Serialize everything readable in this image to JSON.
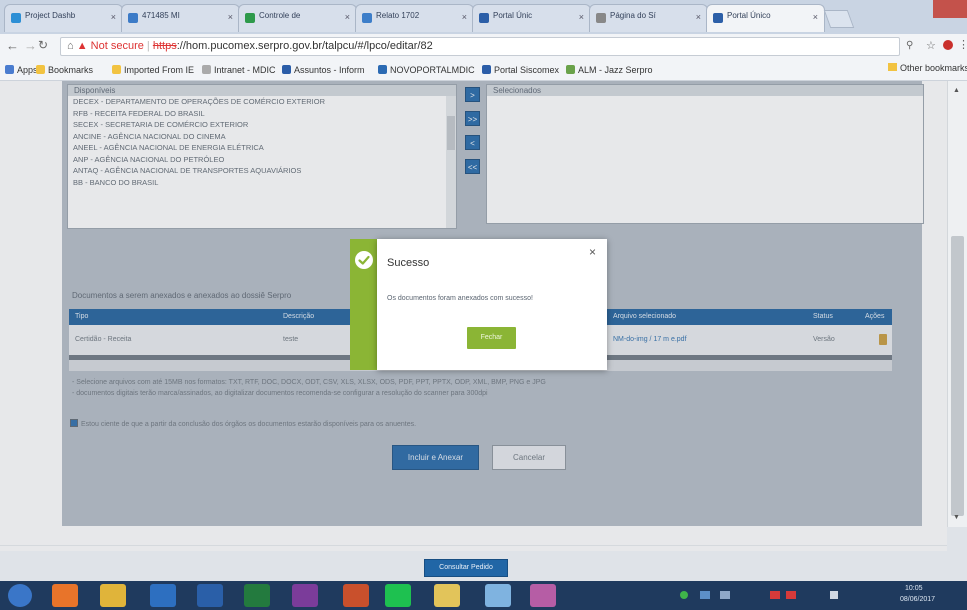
{
  "browser": {
    "tabs": [
      {
        "title": "Project Dashb",
        "fav": "#2d8fd5",
        "active": false
      },
      {
        "title": "471485 MI",
        "fav": "#3c7bc7",
        "active": false
      },
      {
        "title": "Controle de",
        "fav": "#2e9a4b",
        "active": false
      },
      {
        "title": "Relato 1702",
        "fav": "#3d7ec9",
        "active": false
      },
      {
        "title": "Portal Únic",
        "fav": "#2c5fa8",
        "active": false
      },
      {
        "title": "Página do Sí",
        "fav": "#888888",
        "active": false
      },
      {
        "title": "Portal Único",
        "fav": "#2c5fa8",
        "active": true
      }
    ],
    "not_secure_label": "Not secure",
    "url_scheme": "https",
    "url_rest": "://hom.pucomex.serpro.gov.br/talpcu/#/lpco/editar/82",
    "bookmarks": [
      {
        "label": "Apps",
        "color": "#4a7ccf"
      },
      {
        "label": "Bookmarks",
        "color": "#f2c341"
      },
      {
        "label": "Imported From IE",
        "color": "#f2c341"
      },
      {
        "label": "Intranet - MDIC",
        "color": "#aaaaaa"
      },
      {
        "label": "Assuntos - Inform",
        "color": "#2b5da8"
      },
      {
        "label": "NOVOPORTALMDIC",
        "color": "#2b6ab3"
      },
      {
        "label": "Portal Siscomex",
        "color": "#2b5da8"
      },
      {
        "label": "ALM - Jazz Serpro",
        "color": "#6aa24a"
      }
    ],
    "other_bookmarks": "Other bookmarks"
  },
  "orgaos": {
    "disponiveis_label": "Disponíveis",
    "selecionados_label": "Selecionados",
    "items": [
      "DECEX - DEPARTAMENTO DE OPERAÇÕES DE COMÉRCIO EXTERIOR",
      "RFB - RECEITA FEDERAL DO BRASIL",
      "SECEX - SECRETARIA DE COMÉRCIO EXTERIOR",
      "ANCINE - AGÊNCIA NACIONAL DO CINEMA",
      "ANEEL - AGÊNCIA NACIONAL DE ENERGIA ELÉTRICA",
      "ANP - AGÊNCIA NACIONAL DO PETRÓLEO",
      "ANTAQ - AGÊNCIA NACIONAL DE TRANSPORTES AQUAVIÁRIOS",
      "BB - BANCO DO BRASIL"
    ],
    "move_buttons": [
      ">",
      ">>",
      "<",
      "<<"
    ]
  },
  "documentos": {
    "caption": "Documentos a serem anexados e anexados ao dossiê Serpro",
    "headers": [
      "Tipo",
      "Descrição",
      "Arquivo selecionado",
      "Status",
      "Ações"
    ],
    "row": [
      "Certidão - Receita",
      "teste",
      "NM-do-img / 17 m e.pdf",
      "Versão",
      ""
    ]
  },
  "notes": [
    "- Selecione arquivos com até 15MB nos formatos: TXT, RTF, DOC, DOCX, ODT, CSV, XLS, XLSX, ODS, PDF, PPT, PPTX, ODP, XML, BMP, PNG e JPG",
    "- documentos digitais terão marca/assinados, ao digitalizar documentos recomenda-se configurar a resolução do scanner para 300dpi"
  ],
  "declaration": "Estou ciente de que a partir da conclusão dos órgãos os documentos estarão disponíveis para os anuentes.",
  "buttons": {
    "primary": "Incluir e Anexar",
    "cancel": "Cancelar",
    "consultar": "Consultar Pedido"
  },
  "modal": {
    "title": "Sucesso",
    "message": "Os documentos foram anexados com sucesso!",
    "ok": "Fechar",
    "close": "×",
    "accent": "#8bb535"
  },
  "taskbar": {
    "apps": [
      "windows-start",
      "firefox",
      "chrome",
      "outlook",
      "word",
      "excel",
      "onenote",
      "powerpoint",
      "spotify",
      "explorer",
      "notes",
      "snipping"
    ],
    "time": "10:05",
    "date": "08/06/2017"
  }
}
